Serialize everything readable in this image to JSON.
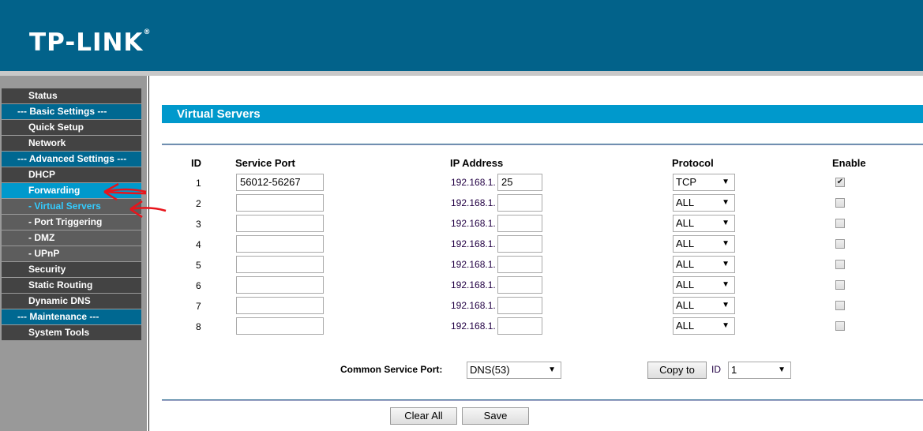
{
  "header": {
    "logo": "TP-LINK",
    "logo_mark": "®"
  },
  "sidebar": {
    "items": [
      {
        "label": "Status",
        "kind": "item"
      },
      {
        "label": "--- Basic Settings ---",
        "kind": "hdr"
      },
      {
        "label": "Quick Setup",
        "kind": "item"
      },
      {
        "label": "Network",
        "kind": "item"
      },
      {
        "label": "--- Advanced Settings ---",
        "kind": "hdr"
      },
      {
        "label": "DHCP",
        "kind": "item"
      },
      {
        "label": "Forwarding",
        "kind": "item active"
      },
      {
        "label": "- Virtual Servers",
        "kind": "sub cur"
      },
      {
        "label": "- Port Triggering",
        "kind": "sub"
      },
      {
        "label": "- DMZ",
        "kind": "sub"
      },
      {
        "label": "- UPnP",
        "kind": "sub"
      },
      {
        "label": "Security",
        "kind": "item"
      },
      {
        "label": "Static Routing",
        "kind": "item"
      },
      {
        "label": "Dynamic DNS",
        "kind": "item"
      },
      {
        "label": "--- Maintenance ---",
        "kind": "hdr"
      },
      {
        "label": "System Tools",
        "kind": "item"
      }
    ]
  },
  "page": {
    "title": "Virtual Servers"
  },
  "table": {
    "headers": {
      "id": "ID",
      "service_port": "Service Port",
      "ip": "IP Address",
      "protocol": "Protocol",
      "enable": "Enable"
    },
    "ip_prefix": "192.168.1.",
    "rows": [
      {
        "id": "1",
        "port": "56012-56267",
        "ip": "25",
        "protocol": "TCP",
        "enabled": true
      },
      {
        "id": "2",
        "port": "",
        "ip": "",
        "protocol": "ALL",
        "enabled": false
      },
      {
        "id": "3",
        "port": "",
        "ip": "",
        "protocol": "ALL",
        "enabled": false
      },
      {
        "id": "4",
        "port": "",
        "ip": "",
        "protocol": "ALL",
        "enabled": false
      },
      {
        "id": "5",
        "port": "",
        "ip": "",
        "protocol": "ALL",
        "enabled": false
      },
      {
        "id": "6",
        "port": "",
        "ip": "",
        "protocol": "ALL",
        "enabled": false
      },
      {
        "id": "7",
        "port": "",
        "ip": "",
        "protocol": "ALL",
        "enabled": false
      },
      {
        "id": "8",
        "port": "",
        "ip": "",
        "protocol": "ALL",
        "enabled": false
      }
    ]
  },
  "common": {
    "label": "Common Service Port:",
    "value": "DNS(53)",
    "copy_label": "Copy to",
    "id_label": "ID",
    "id_value": "1"
  },
  "buttons": {
    "clear": "Clear All",
    "save": "Save"
  },
  "annotation_color": "#e8141b"
}
